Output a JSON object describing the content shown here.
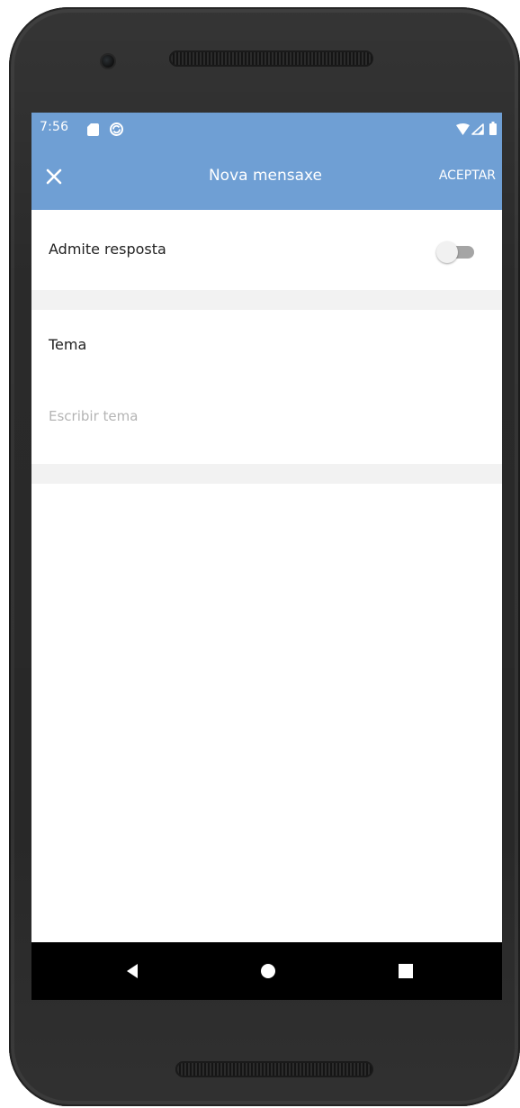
{
  "status_bar": {
    "time": "7:56",
    "icons": [
      "sd-card-icon",
      "sync-icon",
      "wifi-icon",
      "signal-icon",
      "battery-icon"
    ]
  },
  "app_bar": {
    "title": "Nova mensaxe",
    "close_icon": "close-icon",
    "accept_label": "ACEPTAR"
  },
  "reply_setting": {
    "label": "Admite resposta",
    "enabled": false
  },
  "subject": {
    "heading": "Tema",
    "placeholder": "Escribir tema",
    "value": ""
  },
  "nav_bar": {
    "icons": [
      "back-icon",
      "home-icon",
      "recents-icon"
    ]
  },
  "colors": {
    "header": "#6f9fd4",
    "separator": "#f2f2f2",
    "text": "#222222",
    "placeholder": "#b4b4b4",
    "nav_bar": "#000000",
    "device_body": "#2a2a2a"
  }
}
